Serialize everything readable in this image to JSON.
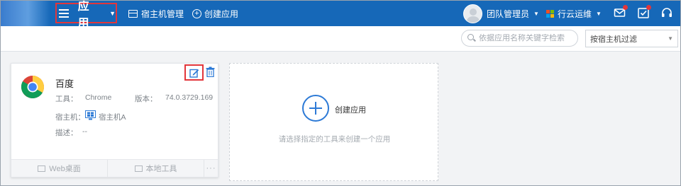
{
  "topbar": {
    "app_title": "应用",
    "nav_host_manage": "宿主机管理",
    "nav_create_app": "创建应用",
    "user_name": "团队管理员",
    "org_name": "行云运维"
  },
  "filter": {
    "search_placeholder": "依据应用名称关键字检索",
    "host_filter_label": "按宿主机过滤"
  },
  "app_card": {
    "name": "百度",
    "tool_label": "工具：",
    "tool_value": "Chrome",
    "version_label": "版本：",
    "version_value": "74.0.3729.169",
    "host_label": "宿主机：",
    "host_value": "宿主机A",
    "desc_label": "描述：",
    "desc_value": "--",
    "footer_web": "Web桌面",
    "footer_local": "本地工具",
    "footer_more": "···"
  },
  "create_card": {
    "label": "创建应用",
    "hint": "请选择指定的工具来创建一个应用"
  },
  "colors": {
    "topbar": "#1668b8",
    "highlight": "#e2363b",
    "accent": "#2d7ad6"
  }
}
